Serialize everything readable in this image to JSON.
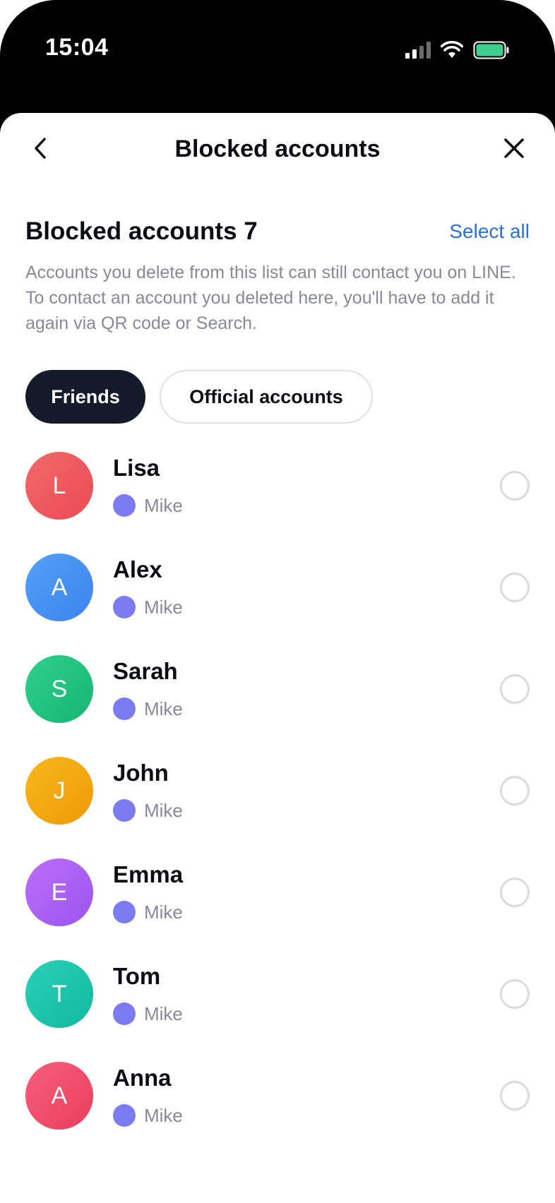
{
  "status_bar": {
    "time": "15:04",
    "icons": [
      "signal-icon",
      "wifi-icon",
      "battery-icon"
    ],
    "battery_color": "#3ccf8e"
  },
  "nav": {
    "title": "Blocked accounts",
    "back_icon": "chevron-left-icon",
    "close_icon": "close-icon"
  },
  "section": {
    "title": "Blocked accounts 7",
    "select_all": "Select all",
    "description": "Accounts you delete from this list can still contact you on LINE. To contact an account you deleted here, you'll have to add it again via QR code or Search."
  },
  "tabs": [
    {
      "label": "Friends",
      "active": true
    },
    {
      "label": "Official accounts",
      "active": false
    }
  ],
  "accounts": [
    {
      "initial": "L",
      "name": "Lisa",
      "sub": "Mike",
      "color": "#f05a5a"
    },
    {
      "initial": "A",
      "name": "Alex",
      "sub": "Mike",
      "color": "#3f8ef0"
    },
    {
      "initial": "S",
      "name": "Sarah",
      "sub": "Mike",
      "color": "#1fbf7d"
    },
    {
      "initial": "J",
      "name": "John",
      "sub": "Mike",
      "color": "#f2a60e"
    },
    {
      "initial": "E",
      "name": "Emma",
      "sub": "Mike",
      "color": "#a65cf2"
    },
    {
      "initial": "T",
      "name": "Tom",
      "sub": "Mike",
      "color": "#17c2a8"
    },
    {
      "initial": "A",
      "name": "Anna",
      "sub": "Mike",
      "color": "#f04a6a"
    }
  ],
  "colors": {
    "accent": "#2d6fd8",
    "tab_active_bg": "#141b2b",
    "sub_dot": "#7b7cf0"
  }
}
